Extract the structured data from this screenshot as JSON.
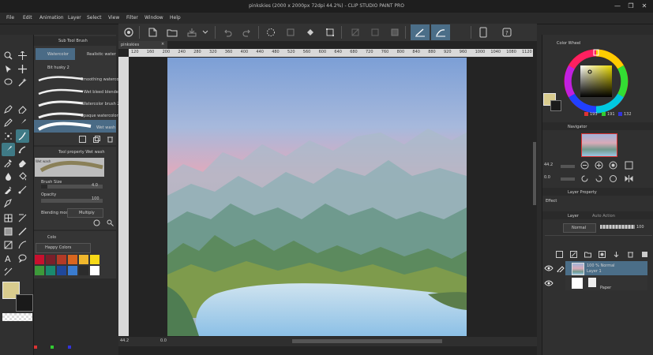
{
  "window": {
    "title": "pinkskies (2000 x 2000px 72dpi 44.2%) - CLIP STUDIO PAINT PRO",
    "minimize": "—",
    "restore": "❐",
    "close": "✕"
  },
  "menu": [
    "File",
    "Edit",
    "Animation",
    "Layer",
    "Select",
    "View",
    "Filter",
    "Window",
    "Help"
  ],
  "subtool": {
    "tab_label": "Sub Tool Brush",
    "group_tabs": [
      "Watercolor",
      "Realistic water"
    ],
    "second_group": "Bit husky 2",
    "brushes": [
      "Smoothing watercolor",
      "Wet bleed blender",
      "Watercolor brush 2",
      "Opaque watercolor 2",
      "Wet wash"
    ]
  },
  "tool_property": {
    "header": "Tool property  Wet wash",
    "preview_label": "Wet wash",
    "brush_size_label": "Brush Size",
    "brush_size_value": "4.0",
    "opacity_label": "Opacity",
    "opacity_value": "100",
    "blending_label": "Blending mode",
    "blending_value": "Multiply"
  },
  "color_set": {
    "tab_label": "Colo",
    "set_name": "Happy Colors",
    "swatches": [
      "#c8102e",
      "#7a1f2a",
      "#b33a26",
      "#d9661f",
      "#f1b82d",
      "#f7d917",
      "#3d9a3a",
      "#1a8a6e",
      "#20489b",
      "#3a7ccf",
      "#2c2c2c",
      "#ffffff"
    ]
  },
  "colors": {
    "main": "#d9cc8e",
    "sub": "#1a1a1a",
    "accent": "#4b6e88"
  },
  "document": {
    "tab": "pinkskies",
    "ruler_ticks": [
      "120",
      "160",
      "200",
      "240",
      "280",
      "320",
      "360",
      "400",
      "440",
      "480",
      "520",
      "560",
      "600",
      "640",
      "680",
      "720",
      "760",
      "800",
      "840",
      "880",
      "920",
      "960",
      "1000",
      "1040",
      "1080",
      "1120",
      "1160",
      "1200",
      "1240",
      "1280",
      "1320",
      "1360",
      "1400",
      "1440",
      "1480",
      "1520",
      "1560",
      "1600",
      "1640",
      "1680",
      "1720",
      "1760",
      "1800",
      "1840",
      "1880",
      "1920",
      "1960",
      "2000",
      "2040",
      "2080",
      "2120",
      "2160",
      "2200",
      "2240"
    ],
    "zoom": "44.2",
    "angle": "0.0"
  },
  "color_wheel": {
    "tab_label": "Color Wheel",
    "h": "193",
    "s": "191",
    "v": "132"
  },
  "navigator": {
    "tab_label": "Navigator",
    "zoom": "44.2",
    "angle": "0.0"
  },
  "layer_property": {
    "tab_label": "Layer Property",
    "effect_label": "Effect"
  },
  "layers": {
    "tab_label": "Layer",
    "tab2_label": "Auto Action",
    "blend_mode": "Normal",
    "opacity": "100",
    "items": [
      {
        "title": "100 % Normal",
        "name": "Layer 1"
      },
      {
        "title": "",
        "name": "Paper"
      }
    ]
  }
}
